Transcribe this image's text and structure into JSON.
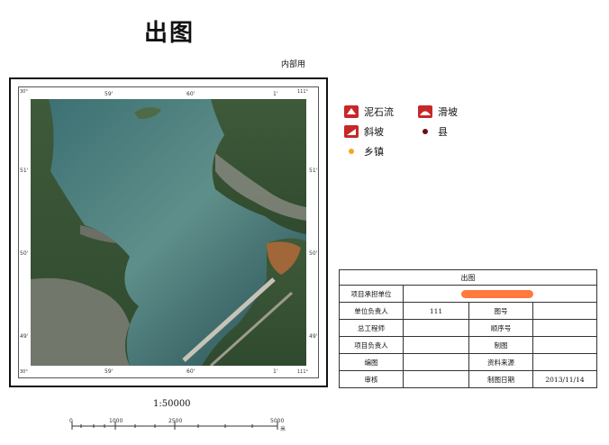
{
  "title": "出图",
  "internal_label": "内部用",
  "map": {
    "top_ticks": [
      "59'",
      "60'",
      "1'"
    ],
    "left_ticks": [
      "51'",
      "50'",
      "49'"
    ],
    "right_ticks": [
      "51'",
      "50'",
      "49'"
    ],
    "bottom_ticks": [
      "59'",
      "60'",
      "1'"
    ],
    "corners": {
      "top_left": "30°",
      "top_right": "111°",
      "bottom_left": "30°",
      "bottom_right": "111°"
    }
  },
  "legend": {
    "items": [
      {
        "label": "泥石流",
        "icon": "debris-flow-icon"
      },
      {
        "label": "滑坡",
        "icon": "landslide-icon"
      },
      {
        "label": "斜坡",
        "icon": "slope-icon"
      },
      {
        "label": "县",
        "icon": "county-dot-icon"
      },
      {
        "label": "乡镇",
        "icon": "town-dot-icon"
      }
    ]
  },
  "colors": {
    "hazard_red": "#c62828",
    "county_dot": "#6d0f12",
    "town_dot": "#f5a623",
    "redaction": "#ff7a3c",
    "water": "#2c5c60"
  },
  "scale": {
    "ratio": "1:50000",
    "ticks": [
      "0",
      "1000",
      "2500",
      "5000"
    ],
    "unit": "米"
  },
  "info_table": {
    "title": "出图",
    "rows": [
      {
        "l1": "项目承担单位",
        "v1": "",
        "l2": "",
        "v2": ""
      },
      {
        "l1": "单位负责人",
        "v1": "111",
        "l2": "图号",
        "v2": ""
      },
      {
        "l1": "总工程师",
        "v1": "",
        "l2": "顺序号",
        "v2": ""
      },
      {
        "l1": "项目负责人",
        "v1": "",
        "l2": "制图",
        "v2": ""
      },
      {
        "l1": "编图",
        "v1": "",
        "l2": "资料来源",
        "v2": ""
      },
      {
        "l1": "审核",
        "v1": "",
        "l2": "制图日期",
        "v2": "2013/11/14"
      }
    ]
  }
}
